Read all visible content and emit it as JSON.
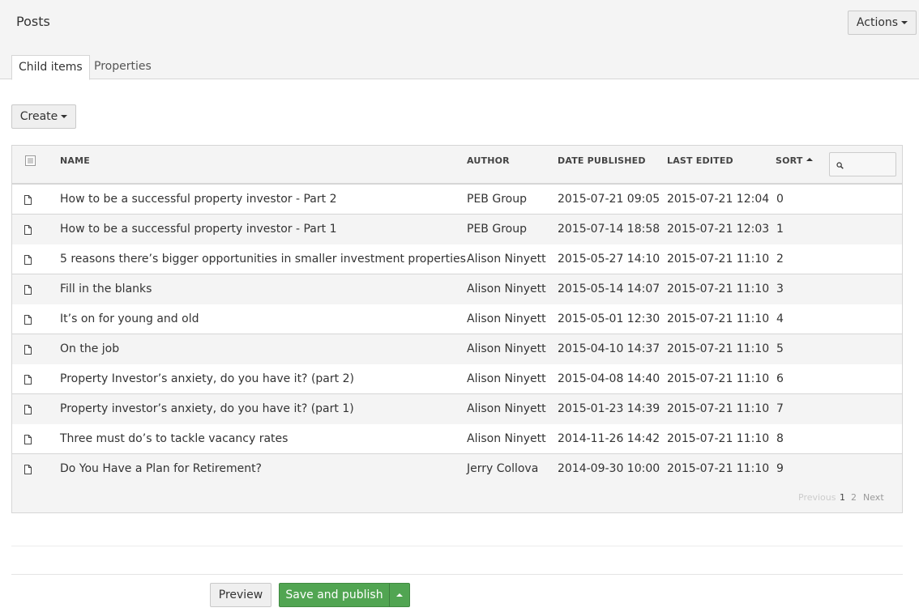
{
  "header": {
    "title": "Posts",
    "actions_label": "Actions"
  },
  "tabs": [
    {
      "label": "Child items",
      "active": true
    },
    {
      "label": "Properties",
      "active": false
    }
  ],
  "toolbar": {
    "create_label": "Create"
  },
  "grid": {
    "columns": {
      "name": "NAME",
      "author": "AUTHOR",
      "date_published": "DATE PUBLISHED",
      "last_edited": "LAST EDITED",
      "sort": "SORT"
    },
    "sort_direction": "ascending",
    "search_value": "",
    "rows": [
      {
        "name": "How to be a successful property investor - Part 2",
        "author": "PEB Group",
        "published": "2015-07-21 09:05",
        "edited": "2015-07-21 12:04",
        "sort": "0"
      },
      {
        "name": "How to be a successful property investor - Part 1",
        "author": "PEB Group",
        "published": "2015-07-14 18:58",
        "edited": "2015-07-21 12:03",
        "sort": "1"
      },
      {
        "name": "5 reasons there’s bigger opportunities in smaller investment properties",
        "author": "Alison Ninyett",
        "published": "2015-05-27 14:10",
        "edited": "2015-07-21 11:10",
        "sort": "2"
      },
      {
        "name": "Fill in the blanks",
        "author": "Alison Ninyett",
        "published": "2015-05-14 14:07",
        "edited": "2015-07-21 11:10",
        "sort": "3"
      },
      {
        "name": "It’s on for young and old",
        "author": "Alison Ninyett",
        "published": "2015-05-01 12:30",
        "edited": "2015-07-21 11:10",
        "sort": "4"
      },
      {
        "name": "On the job",
        "author": "Alison Ninyett",
        "published": "2015-04-10 14:37",
        "edited": "2015-07-21 11:10",
        "sort": "5"
      },
      {
        "name": "Property Investor’s anxiety, do you have it? (part 2)",
        "author": "Alison Ninyett",
        "published": "2015-04-08 14:40",
        "edited": "2015-07-21 11:10",
        "sort": "6"
      },
      {
        "name": "Property investor’s anxiety, do you have it? (part 1)",
        "author": "Alison Ninyett",
        "published": "2015-01-23 14:39",
        "edited": "2015-07-21 11:10",
        "sort": "7"
      },
      {
        "name": "Three must do’s to tackle vacancy rates",
        "author": "Alison Ninyett",
        "published": "2014-11-26 14:42",
        "edited": "2015-07-21 11:10",
        "sort": "8"
      },
      {
        "name": "Do You Have a Plan for Retirement?",
        "author": "Jerry Collova",
        "published": "2014-09-30 10:00",
        "edited": "2015-07-21 11:10",
        "sort": "9"
      }
    ],
    "pagination": {
      "previous": "Previous",
      "pages": [
        "1",
        "2"
      ],
      "current_page": "1",
      "next": "Next"
    }
  },
  "footer": {
    "preview_label": "Preview",
    "publish_label": "Save and publish"
  },
  "colors": {
    "publish_button": "#51a552",
    "topbar_bg": "#f4f4f4",
    "border": "#d6d6d6"
  }
}
